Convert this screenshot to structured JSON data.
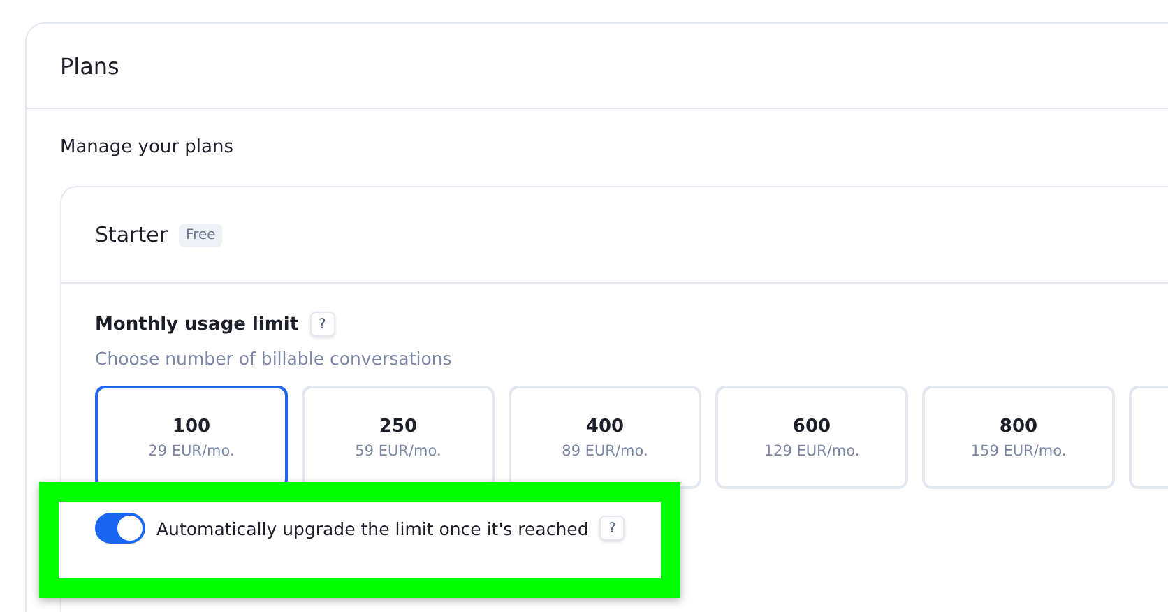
{
  "panel": {
    "title": "Plans"
  },
  "subtitle": "Manage your plans",
  "plan": {
    "name": "Starter",
    "badge": "Free"
  },
  "usage_limit": {
    "label": "Monthly usage limit",
    "help": "?",
    "description": "Choose number of billable conversations",
    "options": [
      {
        "amount": "100",
        "price": "29 EUR/mo.",
        "selected": true
      },
      {
        "amount": "250",
        "price": "59 EUR/mo.",
        "selected": false
      },
      {
        "amount": "400",
        "price": "89 EUR/mo.",
        "selected": false
      },
      {
        "amount": "600",
        "price": "129 EUR/mo.",
        "selected": false
      },
      {
        "amount": "800",
        "price": "159 EUR/mo.",
        "selected": false
      }
    ]
  },
  "auto_upgrade": {
    "label": "Automatically upgrade the limit once it's reached",
    "help": "?",
    "on": true
  }
}
